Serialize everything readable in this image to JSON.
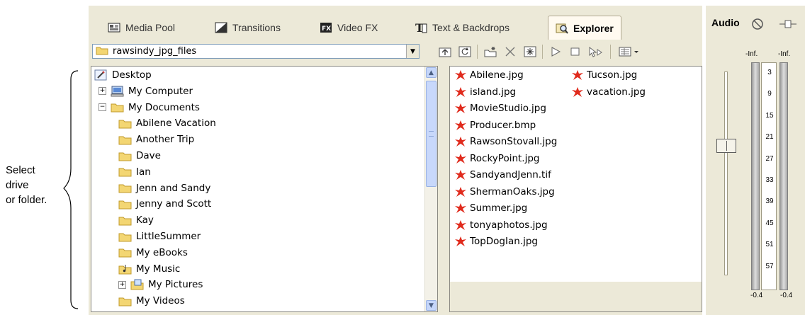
{
  "annotation": {
    "lines": [
      "Select",
      "drive",
      "or folder."
    ]
  },
  "tabs": [
    {
      "label": "Media Pool",
      "icon": "media-pool-icon"
    },
    {
      "label": "Transitions",
      "icon": "transitions-icon"
    },
    {
      "label": "Video FX",
      "icon": "video-fx-icon"
    },
    {
      "label": "Text & Backdrops",
      "icon": "text-backdrops-icon"
    },
    {
      "label": "Explorer",
      "icon": "explorer-icon",
      "active": true
    }
  ],
  "path": {
    "value": "rawsindy_jpg_files"
  },
  "toolbar": {
    "buttons": [
      "up-folder-icon",
      "refresh-icon",
      "new-folder-icon",
      "delete-icon",
      "add-to-project-icon",
      "play-icon",
      "stop-icon",
      "auto-preview-icon",
      "views-icon"
    ]
  },
  "tree": {
    "items": [
      {
        "label": "Desktop",
        "icon": "desktop-icon",
        "level": 0
      },
      {
        "label": "My Computer",
        "icon": "computer-icon",
        "level": 1,
        "expander": "+"
      },
      {
        "label": "My Documents",
        "icon": "folder-icon",
        "level": 1,
        "expander": "−"
      },
      {
        "label": "Abilene Vacation",
        "icon": "folder-icon",
        "level": 2
      },
      {
        "label": "Another Trip",
        "icon": "folder-icon",
        "level": 2
      },
      {
        "label": "Dave",
        "icon": "folder-icon",
        "level": 2
      },
      {
        "label": "Ian",
        "icon": "folder-icon",
        "level": 2
      },
      {
        "label": "Jenn and Sandy",
        "icon": "folder-icon",
        "level": 2
      },
      {
        "label": "Jenny and Scott",
        "icon": "folder-icon",
        "level": 2
      },
      {
        "label": "Kay",
        "icon": "folder-icon",
        "level": 2
      },
      {
        "label": "LittleSummer",
        "icon": "folder-icon",
        "level": 2
      },
      {
        "label": "My eBooks",
        "icon": "folder-icon",
        "level": 2
      },
      {
        "label": "My Music",
        "icon": "music-folder-icon",
        "level": 2
      },
      {
        "label": "My Pictures",
        "icon": "pictures-folder-icon",
        "level": 2,
        "expander": "+"
      },
      {
        "label": "My Videos",
        "icon": "folder-icon",
        "level": 2
      }
    ]
  },
  "files": {
    "column1": [
      "Abilene.jpg",
      "island.jpg",
      "MovieStudio.jpg",
      "Producer.bmp",
      "RawsonStovall.jpg",
      "RockyPoint.jpg",
      "SandyandJenn.tif",
      "ShermanOaks.jpg",
      "Summer.jpg",
      "tonyaphotos.jpg",
      "TopDogIan.jpg"
    ],
    "column2": [
      "Tucson.jpg",
      "vacation.jpg"
    ]
  },
  "audio": {
    "title": "Audio",
    "peak_left": "-Inf.",
    "peak_right": "-Inf.",
    "scale": [
      "3",
      "9",
      "15",
      "21",
      "27",
      "33",
      "39",
      "45",
      "51",
      "57"
    ],
    "bottom_left": "-0.4",
    "bottom_right": "-0.4"
  }
}
